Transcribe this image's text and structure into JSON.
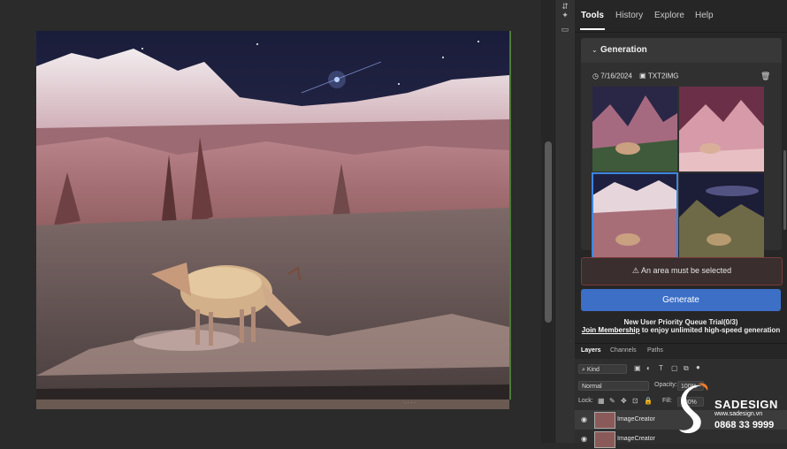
{
  "panel_tabs": [
    "Tools",
    "History",
    "Explore",
    "Help"
  ],
  "generation": {
    "title": "Generation",
    "date": "7/16/2024",
    "mode": "TXT2IMG"
  },
  "alert": "An area must be selected",
  "generate_label": "Generate",
  "queue": {
    "line1": "New User Priority Queue Trial(0/3)",
    "link": "Join Membership",
    "line2_rest": " to enjoy unlimited high-speed generation"
  },
  "layers_panel": {
    "tabs": [
      "Layers",
      "Channels",
      "Paths"
    ],
    "kind": "Kind",
    "blend_mode": "Normal",
    "opacity_label": "Opacity:",
    "opacity": "100%",
    "lock_label": "Lock:",
    "fill_label": "Fill:",
    "fill": "100%",
    "layers": [
      "ImageCreator",
      "ImageCreator"
    ]
  },
  "watermark": {
    "brand": "SADESIGN",
    "site": "www.sadesign.vn",
    "phone": "0868 33 9999"
  },
  "colors": {
    "accent": "#3d6fc7",
    "selection": "#3d86e0",
    "alert_border": "#7a3a3a",
    "panel_bg": "#262626"
  },
  "icons": [
    "chevron-down-icon",
    "calendar-clock-icon",
    "image-icon",
    "trash-icon",
    "warning-icon",
    "eye-icon",
    "search-icon",
    "chat-icon"
  ]
}
